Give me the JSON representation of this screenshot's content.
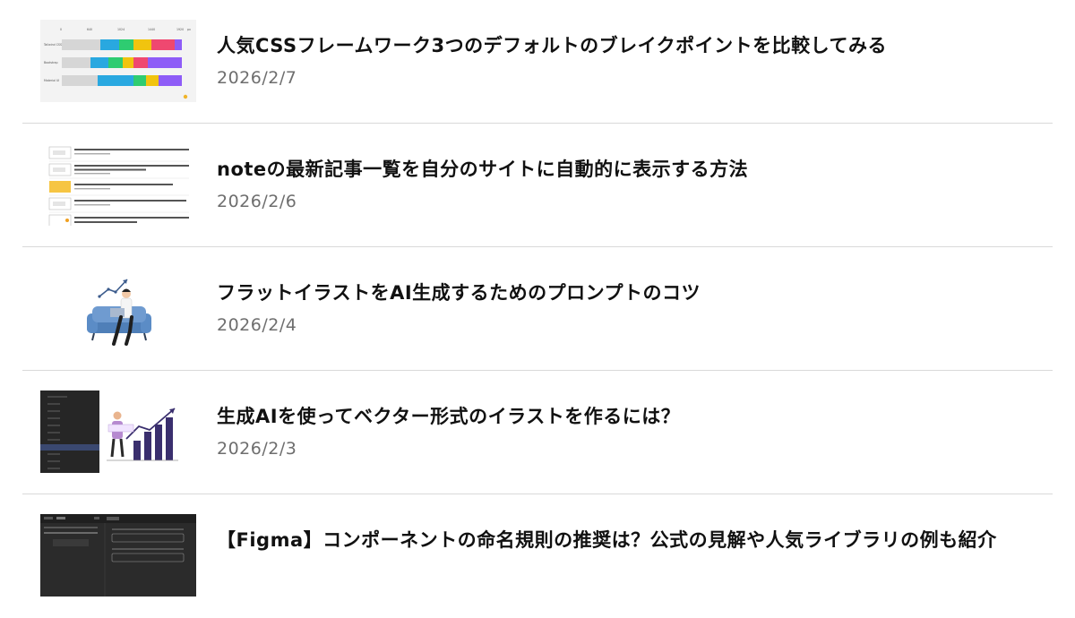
{
  "articles": [
    {
      "title": "人気CSSフレームワーク3つのデフォルトのブレイクポイントを比較してみる",
      "date": "2026/2/7",
      "thumb": {
        "icon": "breakpoint-chart-thumbnail",
        "rows": [
          "Tailwind CSS",
          "Bootstrap",
          "Material UI"
        ],
        "cols": [
          "0",
          "640",
          "1024",
          "1440",
          "1920",
          "px"
        ],
        "colors": [
          "#d6d6d6",
          "#29a8e0",
          "#2ecc71",
          "#f1c40f",
          "#ef4870",
          "#8e5cf7"
        ]
      }
    },
    {
      "title": "noteの最新記事一覧を自分のサイトに自動的に表示する方法",
      "date": "2026/2/6",
      "thumb": {
        "icon": "note-article-list-thumbnail"
      }
    },
    {
      "title": "フラットイラストをAI生成するためのプロンプトのコツ",
      "date": "2026/2/4",
      "thumb": {
        "icon": "flat-illustration-thumbnail"
      }
    },
    {
      "title": "生成AIを使ってベクター形式のイラストを作るには？",
      "date": "2026/2/3",
      "thumb": {
        "icon": "vector-illustration-thumbnail"
      }
    },
    {
      "title": "【Figma】コンポーネントの命名規則の推奨は？公式の見解や人気ライブラリの例も紹介",
      "date": "",
      "thumb": {
        "icon": "figma-panel-thumbnail"
      }
    }
  ]
}
